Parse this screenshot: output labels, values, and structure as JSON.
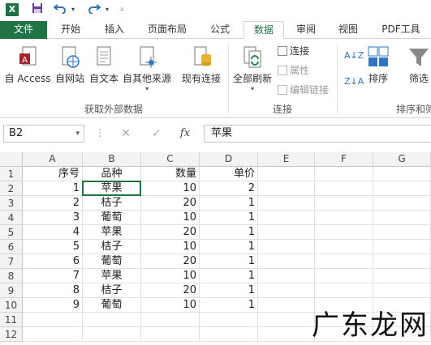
{
  "qat": {
    "app_icon": "excel-logo",
    "app_letter": "X",
    "save_icon": "save-icon",
    "undo_icon": "undo-icon",
    "redo_icon": "redo-icon",
    "customize_icon": "customize-icon"
  },
  "tabs": [
    {
      "label": "文件",
      "active": false,
      "file": true
    },
    {
      "label": "开始",
      "active": false
    },
    {
      "label": "插入",
      "active": false
    },
    {
      "label": "页面布局",
      "active": false
    },
    {
      "label": "公式",
      "active": false
    },
    {
      "label": "数据",
      "active": true
    },
    {
      "label": "审阅",
      "active": false
    },
    {
      "label": "视图",
      "active": false
    },
    {
      "label": "PDF工具",
      "active": false
    }
  ],
  "ribbon": {
    "external": {
      "access": "自 Access",
      "web": "自网站",
      "text": "自文本",
      "other": "自其他来源",
      "existing": "现有连接",
      "group_label": "获取外部数据"
    },
    "connections": {
      "refresh_all": "全部刷新",
      "connections": "连接",
      "properties": "属性",
      "edit_links": "编辑链接",
      "group_label": "连接"
    },
    "sort": {
      "az": "A↓Z",
      "za": "Z↓A",
      "sort": "排序",
      "filter": "筛选",
      "group_label": "排序和筛"
    }
  },
  "formula_bar": {
    "name_box": "B2",
    "cancel": "✕",
    "enter": "✓",
    "fx": "fx",
    "value": "苹果"
  },
  "grid": {
    "columns": [
      "A",
      "B",
      "C",
      "D",
      "E",
      "F",
      "G"
    ],
    "rows": [
      "1",
      "2",
      "3",
      "4",
      "5",
      "6",
      "7",
      "8",
      "9",
      "10",
      "11",
      "12"
    ],
    "header": [
      "序号",
      "品种",
      "数量",
      "单价"
    ],
    "data": [
      [
        "1",
        "苹果",
        "10",
        "2"
      ],
      [
        "2",
        "桔子",
        "20",
        "1"
      ],
      [
        "3",
        "葡萄",
        "10",
        "1"
      ],
      [
        "4",
        "苹果",
        "20",
        "1"
      ],
      [
        "5",
        "桔子",
        "10",
        "1"
      ],
      [
        "6",
        "葡萄",
        "20",
        "1"
      ],
      [
        "7",
        "苹果",
        "10",
        "1"
      ],
      [
        "8",
        "桔子",
        "20",
        "1"
      ],
      [
        "9",
        "葡萄",
        "10",
        "1"
      ]
    ]
  },
  "watermark": "广东龙网",
  "colors": {
    "accent": "#217346",
    "header_bg": "#f3f3f3"
  }
}
